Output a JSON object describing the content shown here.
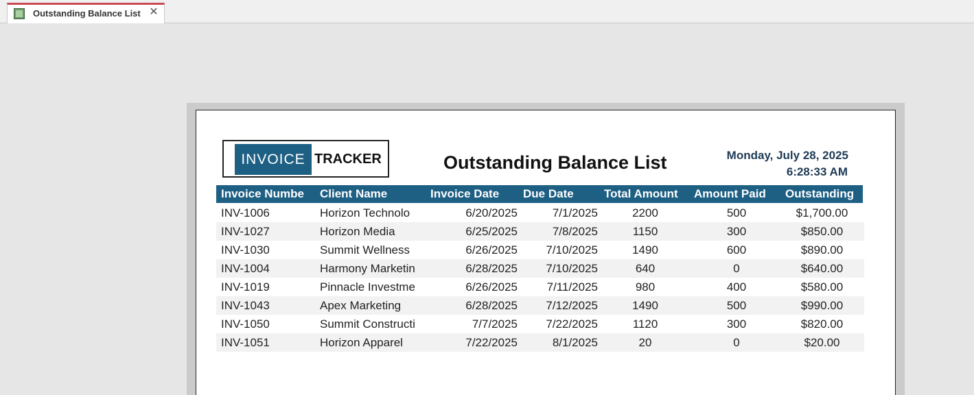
{
  "tab": {
    "title": "Outstanding Balance List",
    "icon": "report-icon",
    "close_glyph": "✕"
  },
  "report": {
    "logo": {
      "left_text": "INVOICE",
      "right_text": "TRACKER",
      "accent": "#1e5f84"
    },
    "title": "Outstanding Balance List",
    "date": "Monday, July 28, 2025",
    "time": "6:28:33 AM",
    "columns": [
      "Invoice Numbe",
      "Client Name",
      "Invoice Date",
      "Due Date",
      "Total Amount",
      "Amount Paid",
      "Outstanding"
    ],
    "rows": [
      [
        "INV-1006",
        "Horizon Technolo",
        "6/20/2025",
        "7/1/2025",
        "2200",
        "500",
        "$1,700.00"
      ],
      [
        "INV-1027",
        "Horizon Media",
        "6/25/2025",
        "7/8/2025",
        "1150",
        "300",
        "$850.00"
      ],
      [
        "INV-1030",
        "Summit Wellness",
        "6/26/2025",
        "7/10/2025",
        "1490",
        "600",
        "$890.00"
      ],
      [
        "INV-1004",
        "Harmony Marketin",
        "6/28/2025",
        "7/10/2025",
        "640",
        "0",
        "$640.00"
      ],
      [
        "INV-1019",
        "Pinnacle Investme",
        "6/26/2025",
        "7/11/2025",
        "980",
        "400",
        "$580.00"
      ],
      [
        "INV-1043",
        "Apex Marketing",
        "6/28/2025",
        "7/12/2025",
        "1490",
        "500",
        "$990.00"
      ],
      [
        "INV-1050",
        "Summit Constructi",
        "7/7/2025",
        "7/22/2025",
        "1120",
        "300",
        "$820.00"
      ],
      [
        "INV-1051",
        "Horizon Apparel",
        "7/22/2025",
        "8/1/2025",
        "20",
        "0",
        "$20.00"
      ]
    ]
  }
}
